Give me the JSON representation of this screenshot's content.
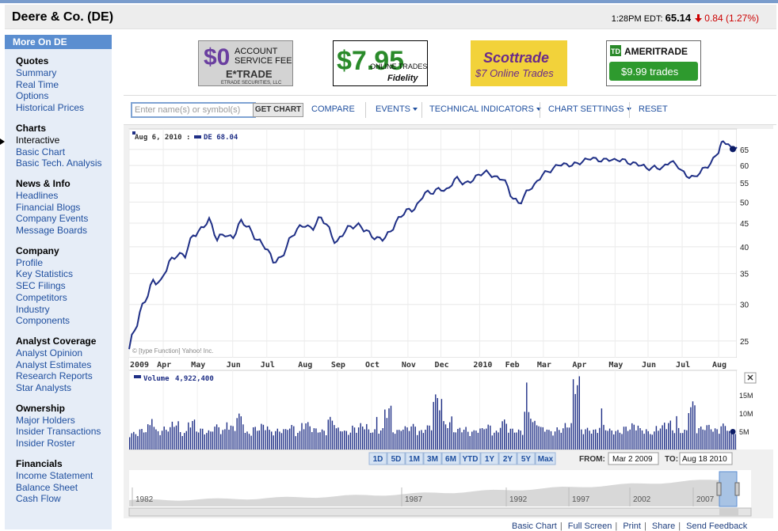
{
  "header": {
    "title": "Deere & Co. (DE)",
    "time_label": "1:28PM EDT:",
    "price": "65.14",
    "change": "0.84 (1.27%)"
  },
  "sidebar": {
    "heading": "More On DE",
    "sections": [
      {
        "title": "Quotes",
        "links": [
          "Summary",
          "Real Time",
          "Options",
          "Historical Prices"
        ]
      },
      {
        "title": "Charts",
        "links": [
          "Interactive",
          "Basic Chart",
          "Basic Tech. Analysis"
        ]
      },
      {
        "title": "News & Info",
        "links": [
          "Headlines",
          "Financial Blogs",
          "Company Events",
          "Message Boards"
        ]
      },
      {
        "title": "Company",
        "links": [
          "Profile",
          "Key Statistics",
          "SEC Filings",
          "Competitors",
          "Industry",
          "Components"
        ]
      },
      {
        "title": "Analyst Coverage",
        "links": [
          "Analyst Opinion",
          "Analyst Estimates",
          "Research Reports",
          "Star Analysts"
        ]
      },
      {
        "title": "Ownership",
        "links": [
          "Major Holders",
          "Insider Transactions",
          "Insider Roster"
        ]
      },
      {
        "title": "Financials",
        "links": [
          "Income Statement",
          "Balance Sheet",
          "Cash Flow"
        ]
      }
    ],
    "current": "Interactive"
  },
  "ads": {
    "etrade": {
      "line1": "ACCOUNT",
      "line2": "SERVICE FEE",
      "big": "$0",
      "brand": "E*TRADE",
      "fine": "ETRADE SECURITIES, LLC"
    },
    "fidelity": {
      "big": "$7.95",
      "line1": "ONLINE TRADES",
      "brand": "Fidelity"
    },
    "scottrade": {
      "brand": "Scottrade",
      "line1": "$7 Online Trades"
    },
    "ameritrade": {
      "brand": "AMERITRADE",
      "logo": "TD",
      "button": "$9.99 trades"
    }
  },
  "toolbar": {
    "search_placeholder": "Enter name(s) or symbol(s)",
    "get_chart": "GET CHART",
    "compare": "COMPARE",
    "events": "EVENTS",
    "technical": "TECHNICAL INDICATORS",
    "settings": "CHART SETTINGS",
    "reset": "RESET"
  },
  "chart": {
    "legend_date": "Aug 6, 2010 :",
    "legend_series": "DE 68.04",
    "credit": "© [type Function] Yahoo! Inc.",
    "volume_label": "Volume",
    "volume_value": "4,922,400",
    "ranges": [
      "1D",
      "5D",
      "1M",
      "3M",
      "6M",
      "YTD",
      "1Y",
      "2Y",
      "5Y",
      "Max"
    ],
    "from_label": "FROM:",
    "from_value": "Mar 2 2009",
    "to_label": "TO:",
    "to_value": "Aug 18 2010",
    "nav_years": [
      "1982",
      "1987",
      "1992",
      "1997",
      "2002",
      "2007"
    ],
    "accent": "#1f2f86"
  },
  "chart_data": {
    "type": "line",
    "series": [
      {
        "name": "DE",
        "x": [
          "2009-03-02",
          "2009-03-09",
          "2009-03-16",
          "2009-03-23",
          "2009-03-30",
          "2009-04-06",
          "2009-04-13",
          "2009-04-20",
          "2009-04-27",
          "2009-05-04",
          "2009-05-11",
          "2009-05-18",
          "2009-05-25",
          "2009-06-01",
          "2009-06-08",
          "2009-06-15",
          "2009-06-22",
          "2009-06-29",
          "2009-07-06",
          "2009-07-13",
          "2009-07-20",
          "2009-07-27",
          "2009-08-03",
          "2009-08-10",
          "2009-08-17",
          "2009-08-24",
          "2009-08-31",
          "2009-09-07",
          "2009-09-14",
          "2009-09-21",
          "2009-09-28",
          "2009-10-05",
          "2009-10-12",
          "2009-10-19",
          "2009-10-26",
          "2009-11-02",
          "2009-11-09",
          "2009-11-16",
          "2009-11-23",
          "2009-11-30",
          "2009-12-07",
          "2009-12-14",
          "2009-12-21",
          "2009-12-28",
          "2010-01-04",
          "2010-01-11",
          "2010-01-18",
          "2010-01-25",
          "2010-02-01",
          "2010-02-08",
          "2010-02-15",
          "2010-02-22",
          "2010-03-01",
          "2010-03-08",
          "2010-03-15",
          "2010-03-22",
          "2010-03-29",
          "2010-04-05",
          "2010-04-12",
          "2010-04-19",
          "2010-04-26",
          "2010-05-03",
          "2010-05-10",
          "2010-05-17",
          "2010-05-24",
          "2010-05-31",
          "2010-06-07",
          "2010-06-14",
          "2010-06-21",
          "2010-06-28",
          "2010-07-05",
          "2010-07-12",
          "2010-07-19",
          "2010-07-26",
          "2010-08-02",
          "2010-08-06",
          "2010-08-13",
          "2010-08-18"
        ],
        "values": [
          24,
          27,
          31,
          34,
          33,
          37,
          39,
          38,
          42,
          44,
          46,
          41,
          43,
          42,
          45,
          44,
          42,
          40,
          37,
          38,
          41,
          43,
          45,
          44,
          46,
          44,
          41,
          43,
          44,
          45,
          43,
          41,
          42,
          44,
          46,
          48,
          49,
          52,
          52,
          54,
          53,
          56,
          55,
          56,
          57,
          58,
          57,
          56,
          51,
          50,
          53,
          54,
          58,
          59,
          60,
          60,
          61,
          61,
          62,
          62,
          62,
          61,
          62,
          61,
          60,
          59,
          60,
          59,
          61,
          60,
          57,
          56,
          59,
          61,
          64,
          68,
          66,
          65
        ]
      }
    ],
    "y_scale": "log",
    "y_ticks": [
      25,
      30,
      35,
      40,
      45,
      50,
      55,
      60,
      65
    ],
    "x_ticks": [
      "2009",
      "Apr",
      "May",
      "Jun",
      "Jul",
      "Aug",
      "Sep",
      "Oct",
      "Nov",
      "Dec",
      "2010",
      "Feb",
      "Mar",
      "Apr",
      "May",
      "Jun",
      "Jul",
      "Aug"
    ],
    "volume": {
      "name": "Volume",
      "y_ticks": [
        "5M",
        "10M",
        "15M"
      ],
      "values_m": [
        4.2,
        5.0,
        6.1,
        4.8,
        5.5,
        6.8,
        4.4,
        7.2,
        5.1,
        4.6,
        6.0,
        4.9,
        5.8,
        8.6,
        4.3,
        5.5,
        6.2,
        4.7,
        5.0,
        5.9,
        4.4,
        6.6,
        5.2,
        4.8,
        7.8,
        5.3,
        4.6,
        5.7,
        6.3,
        4.9,
        5.1,
        10.5,
        4.8,
        5.6,
        6.1,
        4.7,
        5.9,
        13.2,
        6.8,
        5.0,
        5.4,
        4.6,
        5.2,
        6.0,
        4.5,
        7.2,
        5.1,
        4.8,
        10.0,
        6.9,
        5.5,
        4.7,
        5.3,
        6.4,
        17.5,
        5.2,
        4.9,
        6.2,
        5.0,
        4.7,
        5.6,
        6.3,
        5.1,
        4.4,
        5.8,
        6.9,
        5.2,
        4.8,
        11.5,
        5.5,
        6.0,
        5.1,
        6.2,
        4.7,
        4.9
      ]
    },
    "ylim": [
      24,
      70
    ]
  }
}
